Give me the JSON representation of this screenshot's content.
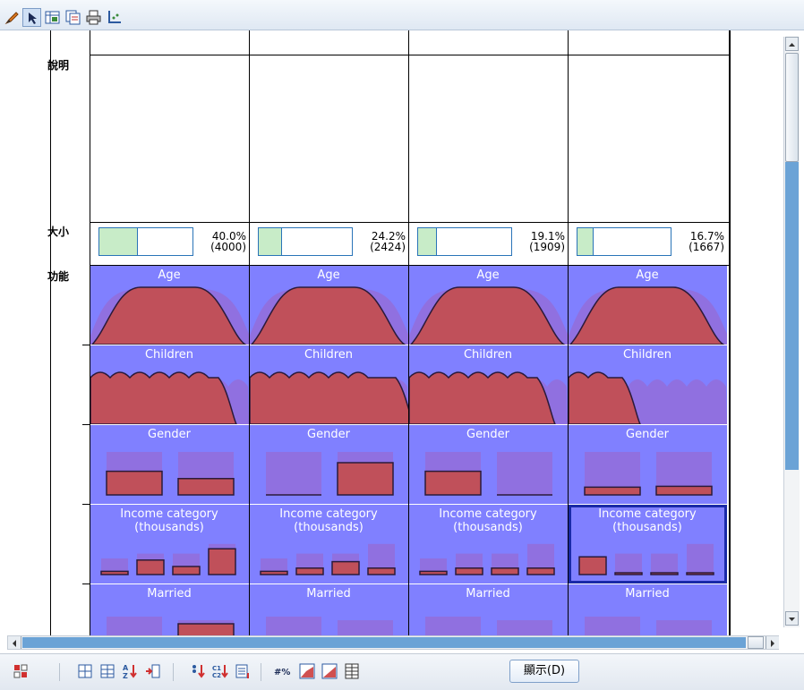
{
  "toolbar": {
    "icons": [
      "pencil-icon",
      "pointer-icon",
      "pivot-icon",
      "copy-icon",
      "print-icon",
      "axis-icon"
    ]
  },
  "grid": {
    "row_labels": {
      "description": "說明",
      "size": "大小",
      "features": "功能"
    },
    "clusters": [
      {
        "percent": "40.0%",
        "count": "(4000)",
        "fill": 0.4,
        "features": {
          "Age": "Age",
          "Children": "Children",
          "Gender": "Gender",
          "Income": "Income category (thousands)",
          "Married": "Married",
          "gender_levels": [
            0.55,
            0.38
          ],
          "income_levels": [
            0.1,
            0.45,
            0.25,
            0.8
          ]
        }
      },
      {
        "percent": "24.2%",
        "count": "(2424)",
        "fill": 0.242,
        "features": {
          "Age": "Age",
          "Children": "Children",
          "Gender": "Gender",
          "Income": "Income category (thousands)",
          "Married": "Married",
          "gender_levels": [
            0.0,
            0.75
          ],
          "income_levels": [
            0.1,
            0.2,
            0.4,
            0.2
          ]
        }
      },
      {
        "percent": "19.1%",
        "count": "(1909)",
        "fill": 0.191,
        "features": {
          "Age": "Age",
          "Children": "Children",
          "Gender": "Gender",
          "Income": "Income category (thousands)",
          "Married": "Married",
          "gender_levels": [
            0.55,
            0.0
          ],
          "income_levels": [
            0.1,
            0.2,
            0.2,
            0.2
          ]
        }
      },
      {
        "percent": "16.7%",
        "count": "(1667)",
        "fill": 0.167,
        "features": {
          "Age": "Age",
          "Children": "Children",
          "Gender": "Gender",
          "Income": "Income category (thousands)",
          "Married": "Married",
          "gender_levels": [
            0.18,
            0.2
          ],
          "income_levels": [
            0.55,
            0.05,
            0.05,
            0.05
          ]
        }
      }
    ]
  },
  "bottom_toolbar": {
    "icons": [
      "transpose-icon",
      "grid-icon",
      "grid-alt-icon",
      "sort-az-icon",
      "insert-icon",
      "sort-cluster-icon",
      "sort-c1c2-icon",
      "list-icon",
      "hash-percent-icon",
      "chart-icon",
      "chart-filled-icon",
      "table-icon"
    ],
    "show_button": "顯示(D)"
  },
  "colors": {
    "feature_bg": "#8080ff",
    "distribution": "#c0505a",
    "overall": "#9070e0",
    "size_fill": "#c8ecc8",
    "size_border": "#2a74b8",
    "selected_border": "#1a2aa8",
    "toolbar_bg": "#e8eef6"
  }
}
